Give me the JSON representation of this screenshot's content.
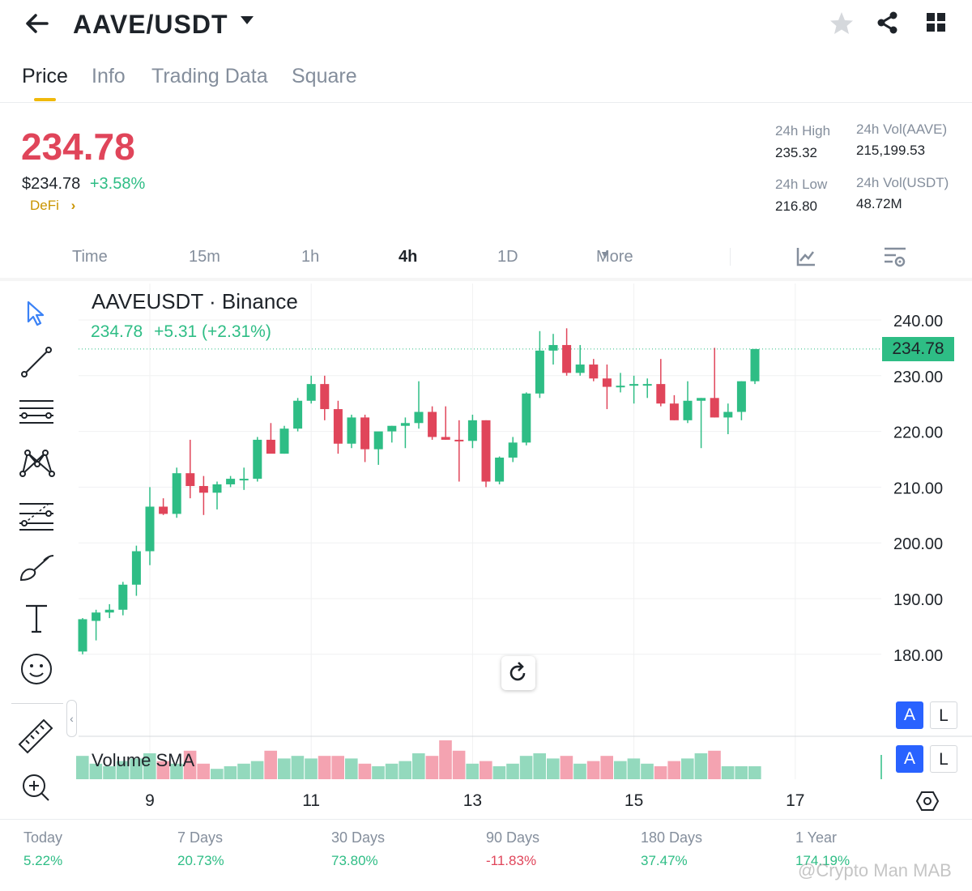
{
  "header": {
    "pair": "AAVE/USDT",
    "icons": [
      "back-arrow-icon",
      "dropdown-caret-icon",
      "star-icon",
      "share-icon",
      "grid-menu-icon"
    ]
  },
  "tabs": [
    {
      "label": "Price",
      "active": true
    },
    {
      "label": "Info",
      "active": false
    },
    {
      "label": "Trading Data",
      "active": false
    },
    {
      "label": "Square",
      "active": false
    }
  ],
  "price": {
    "last": "234.78",
    "usd": "$234.78",
    "change_pct": "+3.58%",
    "category": "DeFi",
    "color_up": "#2ebd85",
    "color_down": "#e0455a"
  },
  "stats": {
    "high_label": "24h High",
    "high_value": "235.32",
    "low_label": "24h Low",
    "low_value": "216.80",
    "vol_base_label": "24h Vol(AAVE)",
    "vol_base_value": "215,199.53",
    "vol_quote_label": "24h Vol(USDT)",
    "vol_quote_value": "48.72M"
  },
  "intervals": {
    "items": [
      "Time",
      "15m",
      "1h",
      "4h",
      "1D"
    ],
    "active": "4h",
    "more": "More"
  },
  "chart_data": {
    "type": "candlestick",
    "symbol_title": "AAVEUSDT · Binance",
    "legend_value": "234.78",
    "legend_change": "+5.31 (+2.31%)",
    "current_price_label": "234.78",
    "current_price": 234.78,
    "y_ticks": [
      "240.00",
      "230.00",
      "220.00",
      "210.00",
      "200.00",
      "190.00",
      "180.00"
    ],
    "y_range": [
      172,
      242
    ],
    "x_tick_labels": [
      "9",
      "11",
      "13",
      "15",
      "17"
    ],
    "x_tick_index": [
      5,
      17,
      29,
      41,
      53
    ],
    "volume_label": "Volume SMA",
    "candles": [
      {
        "o": 180.5,
        "h": 186.5,
        "l": 180.0,
        "c": 186.3
      },
      {
        "o": 186.0,
        "h": 188.0,
        "l": 182.5,
        "c": 187.5
      },
      {
        "o": 187.5,
        "h": 189.0,
        "l": 186.5,
        "c": 188.0
      },
      {
        "o": 188.0,
        "h": 193.0,
        "l": 187.0,
        "c": 192.5
      },
      {
        "o": 192.5,
        "h": 199.5,
        "l": 190.5,
        "c": 198.5
      },
      {
        "o": 198.5,
        "h": 210.0,
        "l": 196.0,
        "c": 206.5
      },
      {
        "o": 206.5,
        "h": 208.0,
        "l": 205.0,
        "c": 205.2
      },
      {
        "o": 205.2,
        "h": 213.5,
        "l": 204.5,
        "c": 212.5
      },
      {
        "o": 212.5,
        "h": 218.5,
        "l": 208.0,
        "c": 210.2
      },
      {
        "o": 210.2,
        "h": 212.0,
        "l": 205.0,
        "c": 209.0
      },
      {
        "o": 209.0,
        "h": 211.0,
        "l": 206.0,
        "c": 210.5
      },
      {
        "o": 210.5,
        "h": 212.0,
        "l": 210.0,
        "c": 211.5
      },
      {
        "o": 211.5,
        "h": 213.5,
        "l": 209.5,
        "c": 211.5
      },
      {
        "o": 211.5,
        "h": 219.0,
        "l": 211.0,
        "c": 218.5
      },
      {
        "o": 218.5,
        "h": 221.5,
        "l": 216.5,
        "c": 216.0
      },
      {
        "o": 216.0,
        "h": 221.0,
        "l": 216.0,
        "c": 220.5
      },
      {
        "o": 220.5,
        "h": 226.0,
        "l": 220.0,
        "c": 225.5
      },
      {
        "o": 225.5,
        "h": 230.0,
        "l": 225.0,
        "c": 228.5
      },
      {
        "o": 228.5,
        "h": 230.0,
        "l": 222.0,
        "c": 224.0
      },
      {
        "o": 224.0,
        "h": 225.5,
        "l": 216.0,
        "c": 217.8
      },
      {
        "o": 217.8,
        "h": 223.0,
        "l": 217.0,
        "c": 222.5
      },
      {
        "o": 222.5,
        "h": 223.0,
        "l": 214.5,
        "c": 216.8
      },
      {
        "o": 216.8,
        "h": 219.5,
        "l": 214.0,
        "c": 220.0
      },
      {
        "o": 220.0,
        "h": 221.0,
        "l": 218.0,
        "c": 221.0
      },
      {
        "o": 221.0,
        "h": 222.5,
        "l": 217.0,
        "c": 221.5
      },
      {
        "o": 221.5,
        "h": 229.0,
        "l": 220.5,
        "c": 223.5
      },
      {
        "o": 223.5,
        "h": 224.5,
        "l": 218.5,
        "c": 219.0
      },
      {
        "o": 219.0,
        "h": 224.5,
        "l": 218.5,
        "c": 218.5
      },
      {
        "o": 218.5,
        "h": 222.0,
        "l": 211.0,
        "c": 218.3
      },
      {
        "o": 218.3,
        "h": 223.0,
        "l": 217.0,
        "c": 222.0
      },
      {
        "o": 222.0,
        "h": 222.0,
        "l": 210.0,
        "c": 211.0
      },
      {
        "o": 211.0,
        "h": 215.5,
        "l": 210.5,
        "c": 215.3
      },
      {
        "o": 215.3,
        "h": 219.0,
        "l": 214.5,
        "c": 218.0
      },
      {
        "o": 218.0,
        "h": 227.0,
        "l": 217.5,
        "c": 226.8
      },
      {
        "o": 226.8,
        "h": 238.0,
        "l": 226.0,
        "c": 234.5
      },
      {
        "o": 234.5,
        "h": 237.5,
        "l": 232.0,
        "c": 235.5
      },
      {
        "o": 235.5,
        "h": 238.5,
        "l": 230.0,
        "c": 230.5
      },
      {
        "o": 230.5,
        "h": 235.5,
        "l": 230.0,
        "c": 232.0
      },
      {
        "o": 232.0,
        "h": 233.0,
        "l": 229.0,
        "c": 229.5
      },
      {
        "o": 229.5,
        "h": 232.0,
        "l": 224.0,
        "c": 228.0
      },
      {
        "o": 228.0,
        "h": 230.5,
        "l": 227.0,
        "c": 228.2
      },
      {
        "o": 228.2,
        "h": 230.0,
        "l": 225.0,
        "c": 228.5
      },
      {
        "o": 228.5,
        "h": 229.5,
        "l": 226.0,
        "c": 228.5
      },
      {
        "o": 228.5,
        "h": 233.0,
        "l": 224.5,
        "c": 225.0
      },
      {
        "o": 225.0,
        "h": 226.5,
        "l": 222.0,
        "c": 222.0
      },
      {
        "o": 222.0,
        "h": 229.0,
        "l": 221.5,
        "c": 225.5
      },
      {
        "o": 225.5,
        "h": 226.0,
        "l": 217.0,
        "c": 226.0
      },
      {
        "o": 226.0,
        "h": 235.0,
        "l": 222.5,
        "c": 222.5
      },
      {
        "o": 222.5,
        "h": 225.0,
        "l": 219.5,
        "c": 223.5
      },
      {
        "o": 223.5,
        "h": 229.0,
        "l": 222.0,
        "c": 229.0
      },
      {
        "o": 229.0,
        "h": 234.8,
        "l": 228.5,
        "c": 234.78
      }
    ],
    "volumes": [
      9,
      6,
      5,
      7,
      8,
      10,
      7,
      6,
      11,
      6,
      4,
      5,
      6,
      7,
      11,
      8,
      9,
      8,
      9,
      9,
      8,
      6,
      5,
      6,
      7,
      10,
      9,
      15,
      11,
      6,
      7,
      5,
      6,
      9,
      10,
      8,
      9,
      6,
      7,
      9,
      7,
      8,
      6,
      5,
      7,
      8,
      10,
      11,
      5,
      5,
      5
    ],
    "y_tick_values": [
      240,
      230,
      220,
      210,
      200,
      190,
      180
    ]
  },
  "chart_controls": {
    "auto_label": "A",
    "log_label": "L"
  },
  "performance": [
    {
      "label": "Today",
      "value": "5.22%",
      "dir": "up"
    },
    {
      "label": "7 Days",
      "value": "20.73%",
      "dir": "up"
    },
    {
      "label": "30 Days",
      "value": "73.80%",
      "dir": "up"
    },
    {
      "label": "90 Days",
      "value": "-11.83%",
      "dir": "down"
    },
    {
      "label": "180 Days",
      "value": "37.47%",
      "dir": "up"
    },
    {
      "label": "1 Year",
      "value": "174.19%",
      "dir": "up"
    }
  ],
  "watermark": "@Crypto Man MAB"
}
